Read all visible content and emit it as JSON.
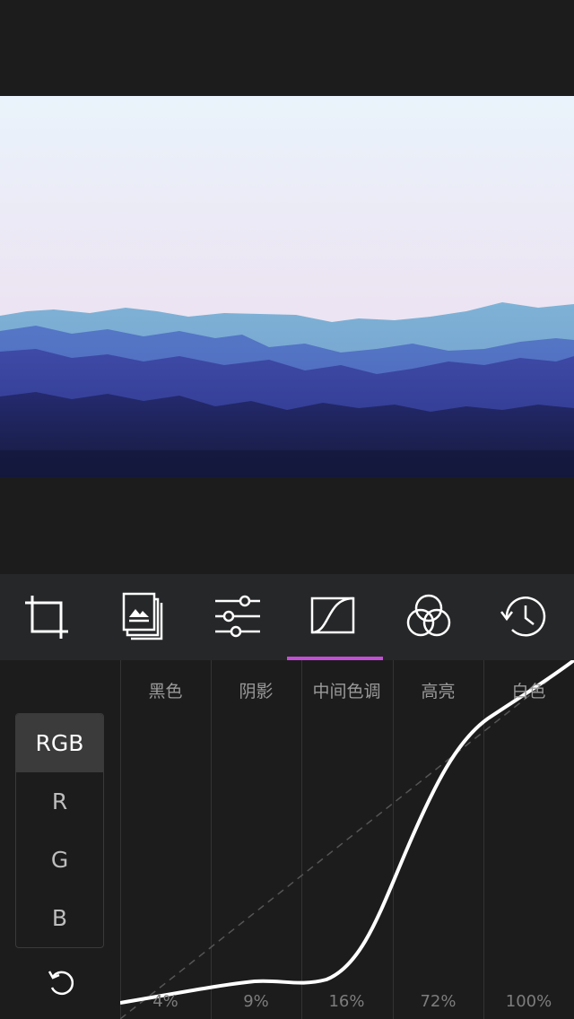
{
  "toolbar": {
    "tools": [
      {
        "icon": "crop-icon"
      },
      {
        "icon": "image-stack-icon"
      },
      {
        "icon": "sliders-icon"
      },
      {
        "icon": "curve-icon",
        "active": true
      },
      {
        "icon": "color-circles-icon"
      },
      {
        "icon": "history-icon"
      }
    ],
    "accent_color": "#c44fd6"
  },
  "channels": {
    "items": [
      "RGB",
      "R",
      "G",
      "B"
    ],
    "selected": "RGB"
  },
  "curve": {
    "ranges": [
      {
        "label": "黑色",
        "value": "4%"
      },
      {
        "label": "阴影",
        "value": "9%"
      },
      {
        "label": "中间色调",
        "value": "16%"
      },
      {
        "label": "高亮",
        "value": "72%"
      },
      {
        "label": "白色",
        "value": "100%"
      }
    ]
  },
  "reset_icon": "reset-icon"
}
